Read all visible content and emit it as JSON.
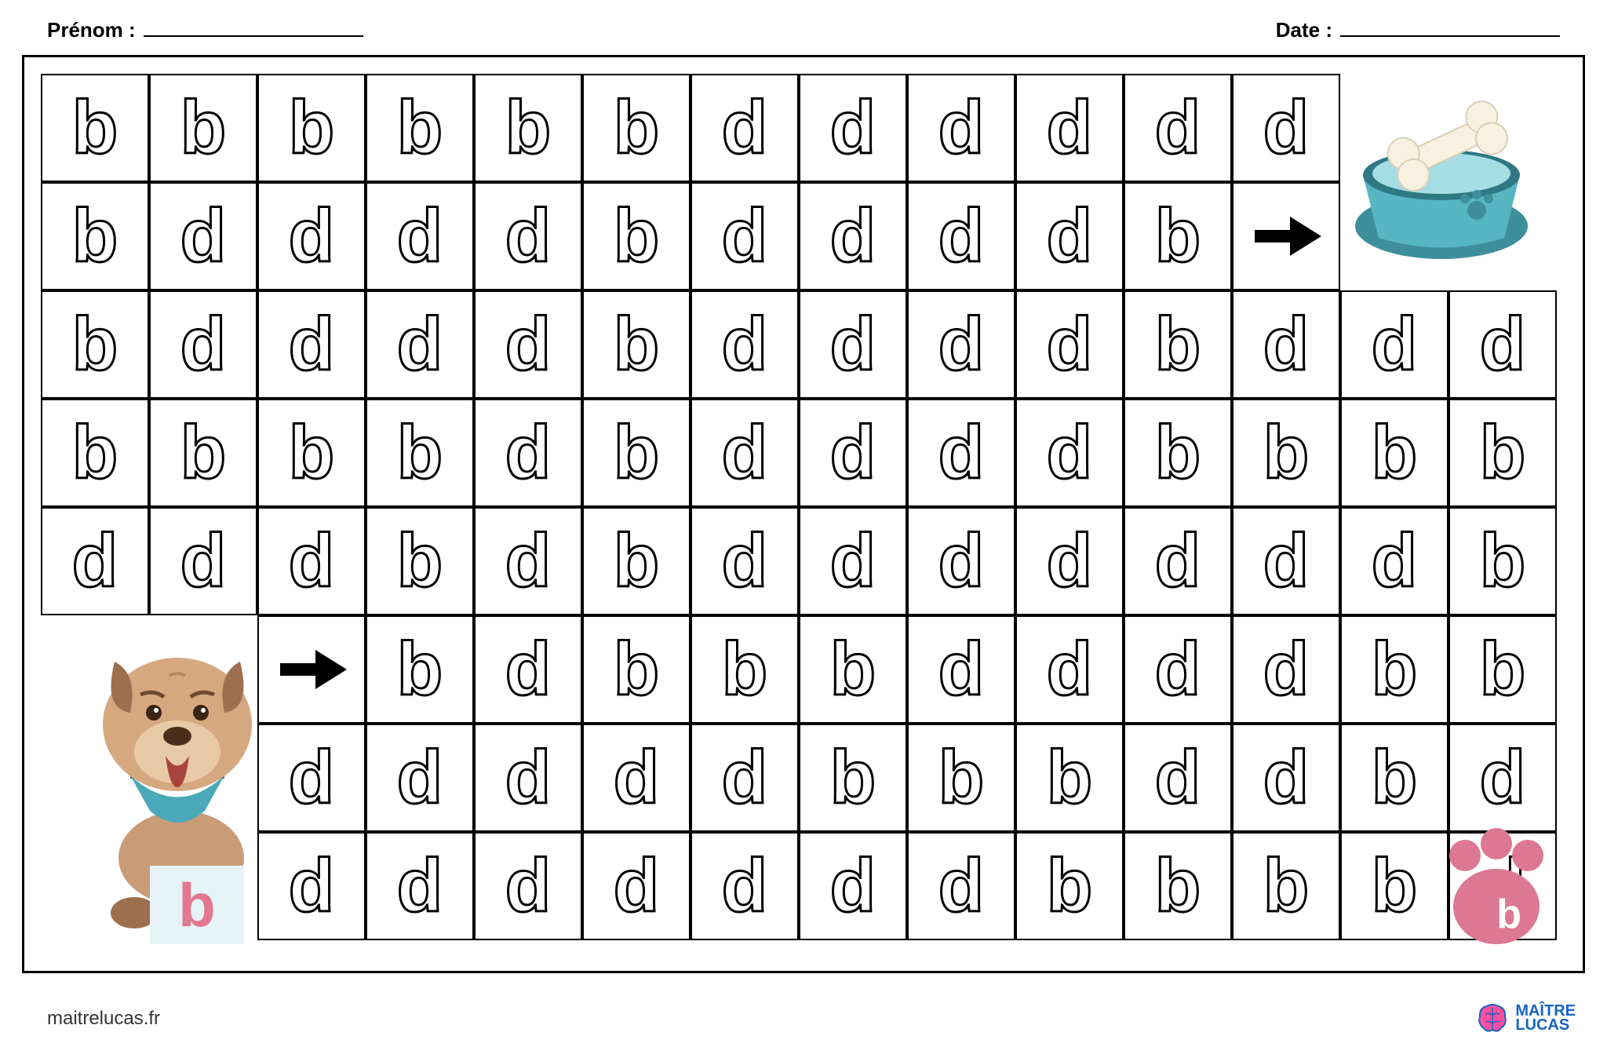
{
  "header": {
    "name_label": "Prénom :",
    "date_label": "Date :"
  },
  "grid": {
    "cols": 14,
    "rows": 8,
    "cells": [
      [
        "b",
        "b",
        "b",
        "b",
        "b",
        "b",
        "d",
        "d",
        "d",
        "d",
        "d",
        "d",
        "",
        ""
      ],
      [
        "b",
        "d",
        "d",
        "d",
        "d",
        "b",
        "d",
        "d",
        "d",
        "d",
        "b",
        "→",
        "",
        ""
      ],
      [
        "b",
        "d",
        "d",
        "d",
        "d",
        "b",
        "d",
        "d",
        "d",
        "d",
        "b",
        "d",
        "d",
        "d"
      ],
      [
        "b",
        "b",
        "b",
        "b",
        "d",
        "b",
        "d",
        "d",
        "d",
        "d",
        "b",
        "b",
        "b",
        "b"
      ],
      [
        "d",
        "d",
        "d",
        "b",
        "d",
        "b",
        "d",
        "d",
        "d",
        "d",
        "d",
        "d",
        "d",
        "b"
      ],
      [
        "",
        "",
        "→",
        "b",
        "d",
        "b",
        "b",
        "b",
        "d",
        "d",
        "d",
        "d",
        "b",
        "b"
      ],
      [
        "",
        "",
        "d",
        "d",
        "d",
        "d",
        "d",
        "b",
        "b",
        "b",
        "d",
        "d",
        "b",
        "d"
      ],
      [
        "",
        "",
        "d",
        "d",
        "d",
        "d",
        "d",
        "d",
        "d",
        "b",
        "b",
        "b",
        "b",
        "d"
      ]
    ]
  },
  "dog_block_letter": "b",
  "paw_letter": "b",
  "footer": {
    "site": "maitrelucas.fr"
  },
  "logo": {
    "line1": "MAÎTRE",
    "line2": "LUCAS"
  },
  "colors": {
    "paw": "#dd7894",
    "bowl": "#57b6c2",
    "bowl_dark": "#3f8e9b",
    "bone": "#f8f1e0",
    "logo_blue": "#1565c0"
  }
}
